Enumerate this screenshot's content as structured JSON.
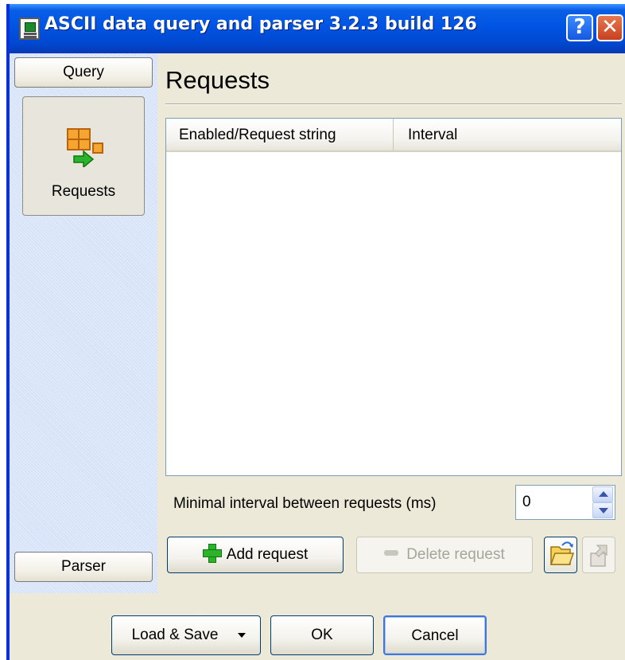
{
  "window": {
    "title": "ASCII data query and parser 3.2.3 build 126",
    "help_label": "?",
    "close_label": "✕",
    "accent_color": "#0054e3"
  },
  "nav": {
    "query_label": "Query",
    "parser_label": "Parser",
    "tile_label": "Requests",
    "tile_icon": "requests-icon"
  },
  "main": {
    "title": "Requests",
    "columns": [
      "Enabled/Request string",
      "Interval"
    ],
    "rows": [],
    "interval_label": "Minimal interval between requests (ms)",
    "interval_value": "0",
    "add_label": "Add request",
    "delete_label": "Delete request",
    "open_icon": "folder-open-icon",
    "save_icon": "save-icon"
  },
  "footer": {
    "load_save_label": "Load & Save",
    "ok_label": "OK",
    "cancel_label": "Cancel"
  }
}
